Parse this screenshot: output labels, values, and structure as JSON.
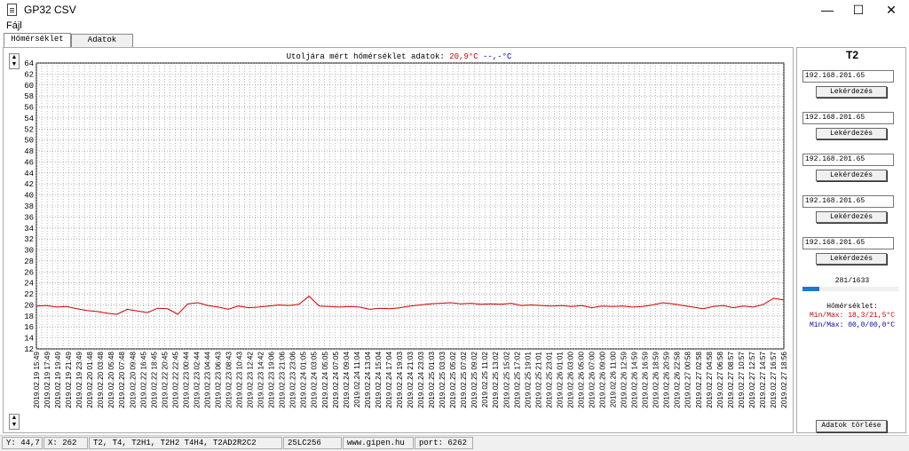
{
  "window": {
    "title": "GP32 CSV",
    "min_glyph": "—",
    "max_glyph": "☐",
    "close_glyph": "✕",
    "icon": "document-icon"
  },
  "menu": {
    "file": "Fájl"
  },
  "tabs": [
    {
      "label": "Hőmérséklet",
      "active": true
    },
    {
      "label": "Adatok",
      "active": false
    }
  ],
  "chart_header": {
    "prefix": "Utoljára mért hőmérséklet adatok:",
    "value_red": "20,9°C",
    "value_blue": "--,-°C"
  },
  "chart_data": {
    "type": "line",
    "ylim": [
      12,
      64
    ],
    "yticks": [
      12,
      14,
      16,
      18,
      20,
      22,
      24,
      26,
      28,
      30,
      32,
      34,
      36,
      38,
      40,
      42,
      44,
      46,
      48,
      50,
      52,
      54,
      56,
      58,
      60,
      62,
      64
    ],
    "grid": true,
    "legend": "none",
    "x": [
      "2019.02.19 15:49",
      "2019.02.19 17:49",
      "2019.02.19 19:49",
      "2019.02.19 21:49",
      "2019.02.19 23:49",
      "2019.02.20 01:48",
      "2019.02.20 03:48",
      "2019.02.20 05:48",
      "2019.02.20 07:48",
      "2019.02.20 09:48",
      "2019.02.22 16:45",
      "2019.02.22 18:45",
      "2019.02.22 20:45",
      "2019.02.22 22:45",
      "2019.02.23 00:44",
      "2019.02.23 02:44",
      "2019.02.23 04:44",
      "2019.02.23 06:43",
      "2019.02.23 08:43",
      "2019.02.23 10:43",
      "2019.02.23 12:42",
      "2019.02.23 14:42",
      "2019.02.23 19:06",
      "2019.02.23 21:06",
      "2019.02.23 23:06",
      "2019.02.24 01:05",
      "2019.02.24 03:05",
      "2019.02.24 05:05",
      "2019.02.24 07:05",
      "2019.02.24 09:04",
      "2019.02.24 11:04",
      "2019.02.24 13:04",
      "2019.02.24 15:04",
      "2019.02.24 17:04",
      "2019.02.24 19:03",
      "2019.02.24 21:03",
      "2019.02.24 23:03",
      "2019.02.25 01:03",
      "2019.02.25 03:03",
      "2019.02.25 05:02",
      "2019.02.25 07:02",
      "2019.02.25 09:02",
      "2019.02.25 11:02",
      "2019.02.25 13:02",
      "2019.02.25 15:02",
      "2019.02.25 17:02",
      "2019.02.25 19:01",
      "2019.02.25 21:01",
      "2019.02.25 23:01",
      "2019.02.26 01:01",
      "2019.02.26 03:00",
      "2019.02.26 05:00",
      "2019.02.26 07:00",
      "2019.02.26 09:00",
      "2019.02.26 11:00",
      "2019.02.26 12:59",
      "2019.02.26 14:59",
      "2019.02.26 16:59",
      "2019.02.26 18:59",
      "2019.02.26 20:59",
      "2019.02.26 22:58",
      "2019.02.27 00:58",
      "2019.02.27 02:58",
      "2019.02.27 04:58",
      "2019.02.27 06:58",
      "2019.02.27 08:57",
      "2019.02.27 10:57",
      "2019.02.27 12:57",
      "2019.02.27 14:57",
      "2019.02.27 16:57",
      "2019.02.27 18:56"
    ],
    "series": [
      {
        "color": "#cc0000",
        "values": [
          19.8,
          19.9,
          19.6,
          19.7,
          19.3,
          19.0,
          18.8,
          18.5,
          18.3,
          19.2,
          18.9,
          18.6,
          19.4,
          19.3,
          18.3,
          20.2,
          20.4,
          19.9,
          19.6,
          19.2,
          19.8,
          19.5,
          19.6,
          19.8,
          20.0,
          19.9,
          20.1,
          21.6,
          19.8,
          19.7,
          19.6,
          19.7,
          19.6,
          19.2,
          19.4,
          19.3,
          19.5,
          19.8,
          20.0,
          20.2,
          20.3,
          20.4,
          20.2,
          20.3,
          20.1,
          20.2,
          20.1,
          20.3,
          19.9,
          20.0,
          19.9,
          19.8,
          19.9,
          19.7,
          19.9,
          19.5,
          19.8,
          19.7,
          19.8,
          19.6,
          19.7,
          20.0,
          20.4,
          20.2,
          19.9,
          19.6,
          19.3,
          19.7,
          19.9,
          19.5,
          19.8,
          19.6,
          20.1,
          21.2,
          20.9
        ]
      }
    ]
  },
  "side": {
    "title": "T2",
    "ips": [
      "192.168.201.65",
      "192.168.201.65",
      "192.168.201.65",
      "192.168.201.65",
      "192.168.201.65"
    ],
    "query_label": "Lekérdezés",
    "counter": "281/1633",
    "progress_fraction": 0.172,
    "temp_label": "Hőmérséklet:",
    "minmax_red": "Min/Max: 18,3/21,5°C",
    "minmax_blue": "Min/Max: 00,0/00,0°C",
    "clear_label": "Adatok törlése"
  },
  "status": {
    "y": "Y: 44,7",
    "x": "X: 262",
    "channels": "T2, T4, T2H1, T2H2  T4H4, T2AD2R2C2",
    "chip": "25LC256",
    "site": "www.gipen.hu",
    "port": "port: 6262"
  }
}
